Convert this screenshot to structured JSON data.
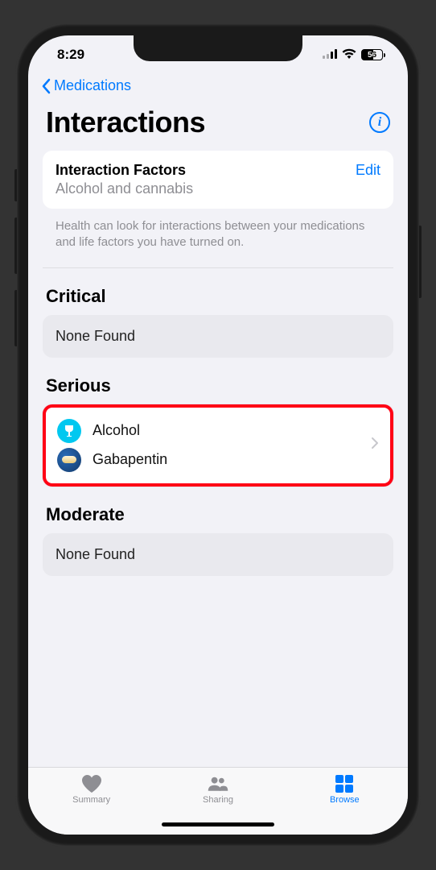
{
  "status": {
    "time": "8:29",
    "battery": "56"
  },
  "nav": {
    "back_label": "Medications"
  },
  "header": {
    "title": "Interactions"
  },
  "factors": {
    "title": "Interaction Factors",
    "edit_label": "Edit",
    "subtitle": "Alcohol and cannabis"
  },
  "note": "Health can look for interactions between your medications and life factors you have turned on.",
  "sections": {
    "critical": {
      "title": "Critical",
      "empty": "None Found"
    },
    "serious": {
      "title": "Serious",
      "items": [
        {
          "label": "Alcohol",
          "icon": "alcohol"
        },
        {
          "label": "Gabapentin",
          "icon": "pill"
        }
      ]
    },
    "moderate": {
      "title": "Moderate",
      "empty": "None Found"
    }
  },
  "tabs": {
    "summary": "Summary",
    "sharing": "Sharing",
    "browse": "Browse"
  }
}
